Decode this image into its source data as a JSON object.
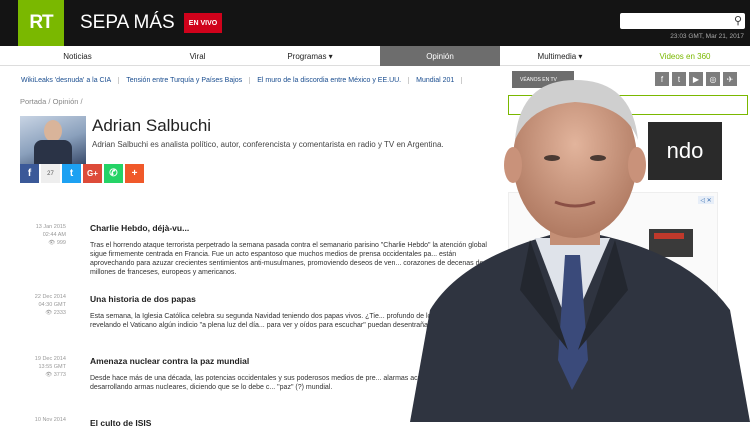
{
  "header": {
    "logo": "RT",
    "brand": "SEPA MÁS",
    "live_label": "EN VIVO",
    "date": "23:03 GMT, Mar 21, 2017",
    "search_placeholder": ""
  },
  "nav": {
    "items": [
      {
        "label": "Noticias"
      },
      {
        "label": "Viral"
      },
      {
        "label": "Programas ▾"
      },
      {
        "label": "Opinión"
      },
      {
        "label": "Multimedia ▾"
      },
      {
        "label": "Videos en 360"
      }
    ]
  },
  "ticker": {
    "items": [
      "WikiLeaks 'desnuda' a la CIA",
      "Tensión entre Turquía y Países Bajos",
      "El muro de la discordia entre México y EE.UU.",
      "Mundial 201"
    ],
    "seen_label": "VÉANOS EN TV"
  },
  "social_icons": [
    "f",
    "t",
    "▶",
    "◎",
    "✈"
  ],
  "breadcrumb": [
    "Portada",
    "/",
    "Opinión",
    "/"
  ],
  "author": {
    "name": "Adrian Salbuchi",
    "description": "Adrian Salbuchi es analista político, autor, conferencista y comentarista en radio y TV en Argentina.",
    "share_count": "27"
  },
  "articles": [
    {
      "date": "13 Jan 2015",
      "time": "02:44 AM",
      "views": "999",
      "title": "Charlie Hebdo, déjà-vu...",
      "body": "Tras el horrendo ataque terrorista perpetrado la semana pasada contra el semanario parisino \"Charlie Hebdo\" la atención global sigue firmemente centrada en Francia. Fue un acto espantoso que muchos medios de prensa occidentales pa... están aprovechando para azuzar crecientes sentimientos anti-musulmanes, promoviendo deseos de ven... corazones de decenas de millones de franceses, europeos y americanos."
    },
    {
      "date": "22 Dec 2014",
      "time": "04:30 GMT",
      "views": "2333",
      "title": "Una historia de dos papas",
      "body": "Esta semana, la Iglesia Católica celebra su segunda Navidad teniendo dos papas vivos. ¿Tie... profundo de lo que parece? ¿Estará revelando el Vaticano algún indicio \"a plena luz del día... para ver y oídos para escuchar\" puedan desentrañar?"
    },
    {
      "date": "19 Dec 2014",
      "time": "13:55 GMT",
      "views": "3773",
      "title": "Amenaza nuclear contra la paz mundial",
      "body": "Desde hace más de una década, las potencias occidentales y sus poderosos medios de pre... alarmas acusando a Irán de estar desarrollando armas nucleares, diciendo que se lo debe c... \"paz\" (?) mundial."
    },
    {
      "date": "10 Nov 2014",
      "time": "",
      "views": "",
      "title": "El culto de ISIS",
      "body": ""
    }
  ],
  "ads": {
    "ad1_text": "ndo",
    "ad2_badge": "◁ ✕"
  },
  "colors": {
    "brand_green": "#7ab800",
    "live_red": "#d0021b",
    "header_bg": "#141414"
  }
}
